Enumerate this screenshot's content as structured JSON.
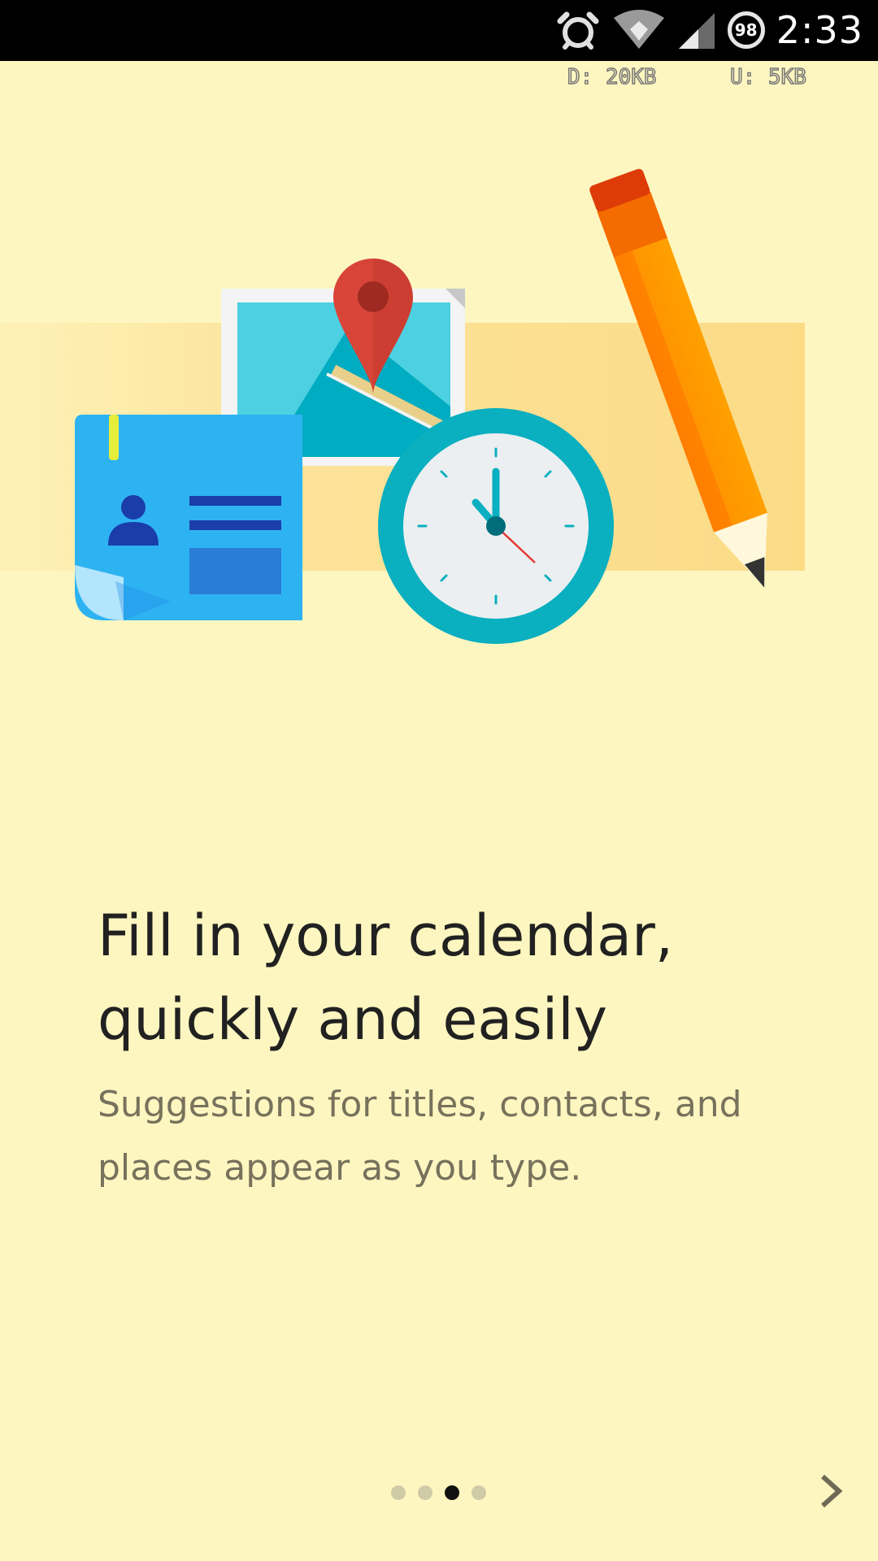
{
  "status_bar": {
    "time": "2:33",
    "battery_level": "98",
    "icons": [
      "alarm-icon",
      "wifi-icon",
      "cell-signal-icon",
      "battery-icon"
    ]
  },
  "traffic": {
    "download": "D: 20KB",
    "upload": "U: 5KB"
  },
  "onboarding": {
    "headline_line1": "Fill in your calendar,",
    "headline_line2": "quickly and easily",
    "subtext_line1": "Suggestions for titles, contacts, and",
    "subtext_line2": "places appear as you type.",
    "page_current": 3,
    "page_total": 4
  },
  "colors": {
    "background": "#FEF6C0",
    "headline": "#212121",
    "subtext": "#77725C",
    "accent_teal": "#0AAFC0",
    "accent_blue": "#2EB3F2",
    "pin_red": "#D84438",
    "pencil_orange": "#FF9100"
  }
}
